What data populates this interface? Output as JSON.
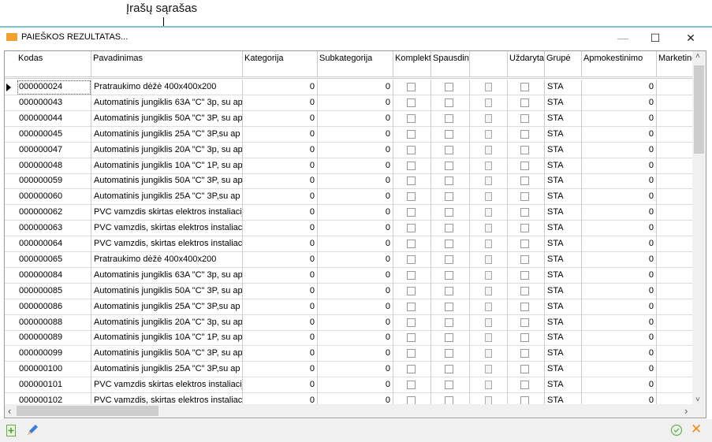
{
  "annotation": "Įrašų sąrašas",
  "window": {
    "title": "PAIEŠKOS REZULTATAS...",
    "minimize": "—",
    "maximize": "☐",
    "close": "✕"
  },
  "columns": [
    "Kodas",
    "Pavadinimas",
    "Kategorija",
    "Subkategorija",
    "Komplekt",
    "Spausdin",
    "",
    "Uždaryta",
    "Grupė",
    "Apmokestinimo",
    "Marketing"
  ],
  "rows": [
    [
      "000000024",
      "Pratraukimo dėžė 400x400x200",
      "0",
      "0",
      "STA",
      "0"
    ],
    [
      "000000043",
      "Automatinis jungiklis 63A \"C\" 3p, su ap",
      "0",
      "0",
      "STA",
      "0"
    ],
    [
      "000000044",
      "Automatinis jungiklis 50A \"C\" 3P, su ap",
      "0",
      "0",
      "STA",
      "0"
    ],
    [
      "000000045",
      "Automatinis jungiklis 25A \"C\" 3P,su ap",
      "0",
      "0",
      "STA",
      "0"
    ],
    [
      "000000047",
      "Automatinis jungiklis 20A \"C\" 3p, su ap",
      "0",
      "0",
      "STA",
      "0"
    ],
    [
      "000000048",
      "Automatinis jungiklis 10A \"C\" 1P, su ap",
      "0",
      "0",
      "STA",
      "0"
    ],
    [
      "000000059",
      "Automatinis jungiklis 50A \"C\" 3P, su ap",
      "0",
      "0",
      "STA",
      "0"
    ],
    [
      "000000060",
      "Automatinis jungiklis 25A \"C\" 3P,su ap",
      "0",
      "0",
      "STA",
      "0"
    ],
    [
      "000000062",
      "PVC vamzdis skirtas elektros instaliacij",
      "0",
      "0",
      "STA",
      "0"
    ],
    [
      "000000063",
      "PVC vamzdis, skirtas elektros instaliac",
      "0",
      "0",
      "STA",
      "0"
    ],
    [
      "000000064",
      "PVC vamzdis, skirtas elektros instaliac",
      "0",
      "0",
      "STA",
      "0"
    ],
    [
      "000000065",
      "Pratraukimo dėžė 400x400x200",
      "0",
      "0",
      "STA",
      "0"
    ],
    [
      "000000084",
      "Automatinis jungiklis 63A \"C\" 3p, su ap",
      "0",
      "0",
      "STA",
      "0"
    ],
    [
      "000000085",
      "Automatinis jungiklis 50A \"C\" 3P, su ap",
      "0",
      "0",
      "STA",
      "0"
    ],
    [
      "000000086",
      "Automatinis jungiklis 25A \"C\" 3P,su ap",
      "0",
      "0",
      "STA",
      "0"
    ],
    [
      "000000088",
      "Automatinis jungiklis 20A \"C\" 3p, su ap",
      "0",
      "0",
      "STA",
      "0"
    ],
    [
      "000000089",
      "Automatinis jungiklis 10A \"C\" 1P, su ap",
      "0",
      "0",
      "STA",
      "0"
    ],
    [
      "000000099",
      "Automatinis jungiklis 50A \"C\" 3P, su ap",
      "0",
      "0",
      "STA",
      "0"
    ],
    [
      "000000100",
      "Automatinis jungiklis 25A \"C\" 3P,su ap",
      "0",
      "0",
      "STA",
      "0"
    ],
    [
      "000000101",
      "PVC vamzdis skirtas elektros instaliacij",
      "0",
      "0",
      "STA",
      "0"
    ],
    [
      "000000102",
      "PVC vamzdis, skirtas elektros instaliac",
      "0",
      "0",
      "STA",
      "0"
    ]
  ],
  "scroll": {
    "up": "˄",
    "down": "˅",
    "left": "‹",
    "right": "›"
  },
  "toolbar": {
    "add_icon": "add-document-icon",
    "edit_icon": "pencil-icon",
    "ok_icon": "check-circle-icon",
    "cancel": "✕"
  }
}
